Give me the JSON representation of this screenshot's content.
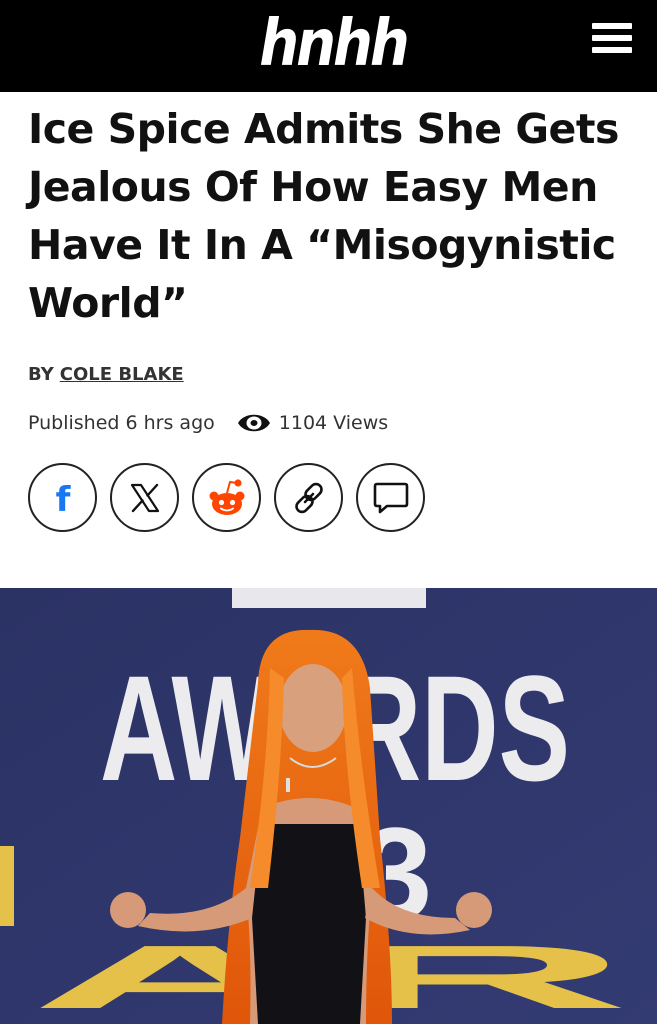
{
  "header": {
    "logo_text": "hnhh",
    "menu_icon": "hamburger-menu-icon",
    "bg_color": "#000000"
  },
  "article": {
    "headline": "Ice Spice Admits She Gets Jealous Of How Easy Men Have It In A “Misogynistic World”",
    "by_label": "BY",
    "author": "COLE BLAKE",
    "published": "Published 6 hrs ago",
    "views": "1104 Views"
  },
  "share": {
    "buttons": [
      {
        "icon": "facebook-icon"
      },
      {
        "icon": "x-twitter-icon"
      },
      {
        "icon": "reddit-icon",
        "color": "#ff4500"
      },
      {
        "icon": "link-icon"
      },
      {
        "icon": "comment-icon"
      }
    ]
  },
  "hero_image": {
    "sign_text_top": "AWARDS",
    "sign_text_bottom": "AR",
    "bg_color": "#2c3466"
  }
}
